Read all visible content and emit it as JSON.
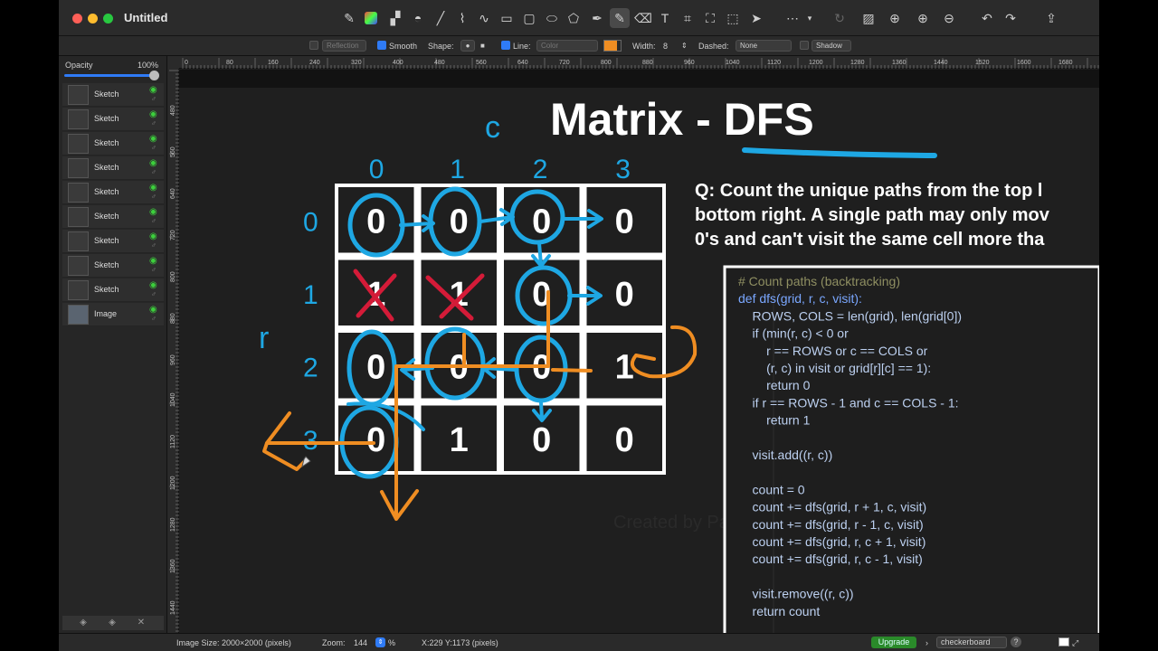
{
  "window": {
    "title": "Untitled"
  },
  "options_bar": {
    "reflection": "Reflection",
    "smooth": "Smooth",
    "shape": "Shape:",
    "line": "Line:",
    "color": "Color",
    "width_label": "Width:",
    "width_value": "8",
    "dashed_label": "Dashed:",
    "dashed_value": "None",
    "shadow": "Shadow",
    "line_color": "#ef8d22"
  },
  "sidebar": {
    "opacity_label": "Opacity",
    "opacity_value": "100%",
    "layers": [
      {
        "name": "Sketch"
      },
      {
        "name": "Sketch"
      },
      {
        "name": "Sketch"
      },
      {
        "name": "Sketch"
      },
      {
        "name": "Sketch"
      },
      {
        "name": "Sketch"
      },
      {
        "name": "Sketch"
      },
      {
        "name": "Sketch"
      },
      {
        "name": "Sketch"
      },
      {
        "name": "Image"
      }
    ]
  },
  "rulers": {
    "top": [
      "0",
      "80",
      "160",
      "240",
      "320",
      "400",
      "480",
      "560",
      "640",
      "720",
      "800",
      "880",
      "960",
      "1040",
      "1120",
      "1200",
      "1280",
      "1360",
      "1440",
      "1520",
      "1600",
      "1680"
    ],
    "left": [
      "480",
      "560",
      "640",
      "720",
      "800",
      "880",
      "960",
      "1040",
      "1120",
      "1200",
      "1280",
      "1360",
      "1440"
    ]
  },
  "slide": {
    "title_plain": "Matrix - ",
    "title_emph": "DFS",
    "question_lines": [
      "Q: Count the unique paths from the top l",
      "bottom right. A single path may only mov",
      "0's and can't visit the same cell more tha"
    ],
    "grid": [
      [
        "0",
        "0",
        "0",
        "0"
      ],
      [
        "1",
        "1",
        "0",
        "0"
      ],
      [
        "0",
        "0",
        "0",
        "1"
      ],
      [
        "0",
        "1",
        "0",
        "0"
      ]
    ],
    "annotations": {
      "c_label": "c",
      "r_label": "r",
      "col_indices": [
        "0",
        "1",
        "2",
        "3"
      ],
      "row_indices": [
        "0",
        "1",
        "2",
        "3"
      ]
    },
    "code_lines": [
      "# Count paths (backtracking)",
      "def dfs(grid, r, c, visit):",
      "    ROWS, COLS = len(grid), len(grid[0])",
      "    if (min(r, c) < 0 or",
      "        r == ROWS or c == COLS or",
      "        (r, c) in visit or grid[r][c] == 1):",
      "        return 0",
      "    if r == ROWS - 1 and c == COLS - 1:",
      "        return 1",
      "",
      "    visit.add((r, c))",
      "",
      "    count = 0",
      "    count += dfs(grid, r + 1, c, visit)",
      "    count += dfs(grid, r - 1, c, visit)",
      "    count += dfs(grid, r, c + 1, visit)",
      "    count += dfs(grid, r, c - 1, visit)",
      "",
      "    visit.remove((r, c))",
      "    return count"
    ],
    "watermark": "Created by Paint"
  },
  "status": {
    "image_size": "Image Size: 2000×2000 (pixels)",
    "zoom_label": "Zoom:",
    "zoom_value": "144",
    "zoom_unit": "%",
    "coords": "X:229 Y:1173 (pixels)",
    "upgrade": "Upgrade",
    "background": "checkerboard",
    "help": "?"
  },
  "colors": {
    "ink_blue": "#1ea7e3",
    "ink_orange": "#ef8d22",
    "ink_red": "#d41b38"
  }
}
